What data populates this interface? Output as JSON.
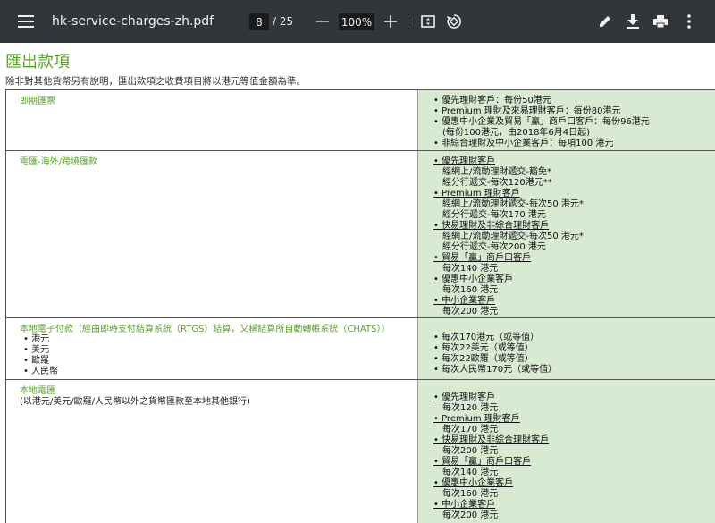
{
  "toolbar": {
    "filename": "hk-service-charges-zh.pdf",
    "page_current": "8",
    "page_total": "/ 25",
    "zoom": "100%"
  },
  "document": {
    "title": "匯出款項",
    "note": "除非對其他貨幣另有說明，匯出款項之收費項目將以港元等值金額為準。",
    "row1": {
      "label": "即期匯票",
      "items": [
        "• 優先理財客戶：每份50港元",
        "• Premium 理財及來易理財客戶：每份80港元",
        "• 優惠中小企業及貿易「贏」商戶口客戶：每份96港元",
        "(每份100港元，由2018年6月4日起)",
        "• 非綜合理財及中小企業客戶：每項100 港元"
      ]
    },
    "row2": {
      "label": "電匯-海外/跨境匯款",
      "items": [
        "• 優先理財客戶",
        "經網上/流動理財遞交-豁免*",
        "經分行遞交-每次120港元**",
        "• Premium 理財客戶",
        "經網上/流動理財遞交-每次50 港元*",
        "經分行遞交-每次170 港元",
        "• 快易理財及非綜合理財客戶",
        "經網上/流動理財遞交-每次50 港元*",
        "經分行遞交-每次200 港元",
        "• 貿易「贏」商戶口客戶",
        "每次140 港元",
        "• 優惠中小企業客戶",
        "每次160 港元",
        "• 中小企業客戶",
        "每次200 港元"
      ]
    },
    "row3": {
      "label": "本地電子付款（經由即時支付結算系統（RTGS）結算，又稱結算所自動轉帳系統（CHATS））",
      "currencies": [
        "• 港元",
        "• 美元",
        "• 歐羅",
        "• 人民幣"
      ],
      "items": [
        "• 每次170港元（或等值）",
        "• 每次22美元（或等值）",
        "• 每次22歐羅（或等值）",
        "• 每次人民幣170元（或等值）"
      ]
    },
    "row4": {
      "label": "本地電匯",
      "sub": "(以港元/美元/歐羅/人民幣以外之貨幣匯款至本地其他銀行)",
      "items": [
        "• 優先理財客戶",
        "每次120 港元",
        "• Premium 理財客戶",
        "每次170 港元",
        "• 快易理財及非綜合理財客戶",
        "每次200 港元",
        "• 貿易「贏」商戶口客戶",
        "每次140 港元",
        "• 優惠中小企業客戶",
        "每次160 港元",
        "• 中小企業客戶",
        "每次200 港元"
      ]
    }
  }
}
